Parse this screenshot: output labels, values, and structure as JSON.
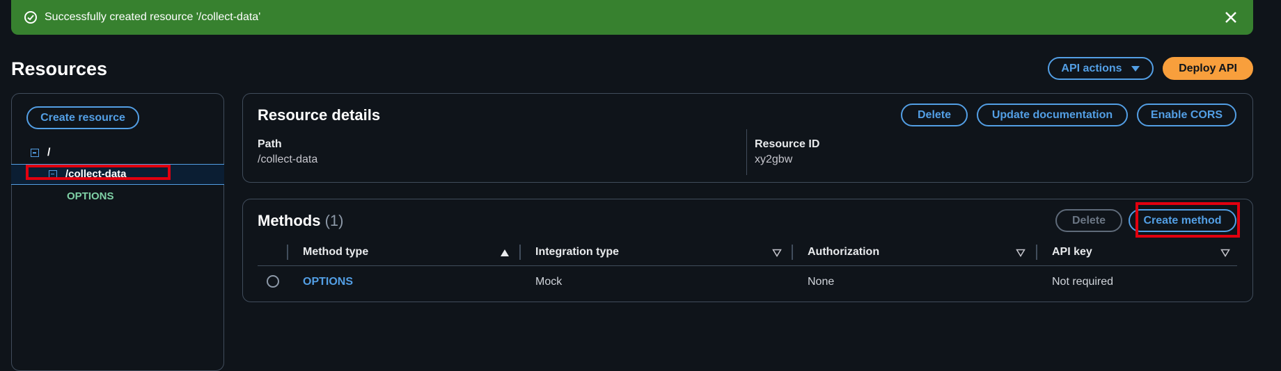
{
  "flash": {
    "message": "Successfully created resource '/collect-data'",
    "color": "#37812f"
  },
  "header": {
    "title": "Resources",
    "api_actions_label": "API actions",
    "deploy_label": "Deploy API"
  },
  "sidebar": {
    "create_resource_label": "Create resource",
    "tree": [
      {
        "label": "/",
        "expanded": true
      },
      {
        "label": "/collect-data",
        "expanded": true,
        "selected": true
      },
      {
        "label": "OPTIONS",
        "method": true
      }
    ]
  },
  "resource_details": {
    "title": "Resource details",
    "delete_label": "Delete",
    "update_docs_label": "Update documentation",
    "enable_cors_label": "Enable CORS",
    "path_label": "Path",
    "path_value": "/collect-data",
    "resource_id_label": "Resource ID",
    "resource_id_value": "xy2gbw"
  },
  "methods": {
    "title": "Methods",
    "count": "(1)",
    "delete_label": "Delete",
    "create_method_label": "Create method",
    "columns": [
      "Method type",
      "Integration type",
      "Authorization",
      "API key"
    ],
    "rows": [
      {
        "method_type": "OPTIONS",
        "integration_type": "Mock",
        "authorization": "None",
        "api_key": "Not required"
      }
    ]
  },
  "colors": {
    "accent": "#539fe5",
    "primary_button": "#f89f3c",
    "method_green": "#7fd1a6",
    "highlight_red": "#e1000f"
  }
}
